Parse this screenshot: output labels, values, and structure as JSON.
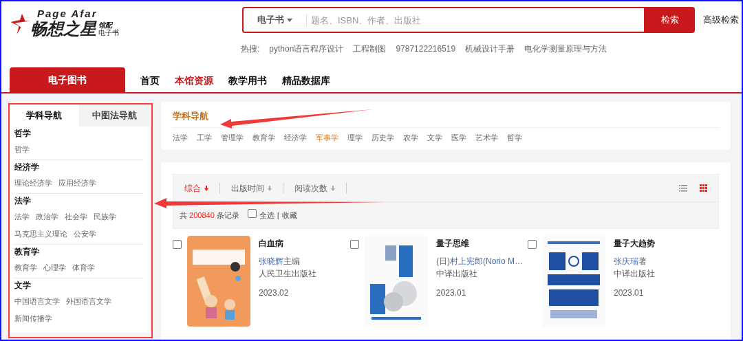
{
  "logo": {
    "latin": "Page Afar",
    "name": "畅想之星",
    "badge_top": "馆配",
    "badge_bottom": "电子书"
  },
  "search": {
    "scope": "电子书",
    "placeholder": "题名、ISBN、作者、出版社",
    "button": "检索",
    "advanced": "高级检索"
  },
  "hot": {
    "label": "热搜:",
    "terms": [
      "python语言程序设计",
      "工程制图",
      "9787122216519",
      "机械设计手册",
      "电化学测量原理与方法"
    ]
  },
  "category_tab": "电子图书",
  "nav": [
    {
      "label": "首页",
      "selected": false
    },
    {
      "label": "本馆资源",
      "selected": true
    },
    {
      "label": "教学用书",
      "selected": false
    },
    {
      "label": "精品数据库",
      "selected": false
    }
  ],
  "sidebar": {
    "tabs": [
      {
        "label": "学科导航",
        "selected": true
      },
      {
        "label": "中图法导航",
        "selected": false
      }
    ],
    "groups": [
      {
        "title": "哲学",
        "links": [
          "哲学"
        ]
      },
      {
        "title": "经济学",
        "links": [
          "理论经济学",
          "应用经济学"
        ]
      },
      {
        "title": "法学",
        "links": [
          "法学",
          "政治学",
          "社会学",
          "民族学",
          "马克思主义理论",
          "公安学"
        ]
      },
      {
        "title": "教育学",
        "links": [
          "教育学",
          "心理学",
          "体育学"
        ]
      },
      {
        "title": "文学",
        "links": [
          "中国语言文学",
          "外国语言文学",
          "新闻传播学"
        ]
      }
    ]
  },
  "subjects": {
    "title": "学科导航",
    "items": [
      {
        "label": "法学",
        "selected": false
      },
      {
        "label": "工学",
        "selected": false
      },
      {
        "label": "管理学",
        "selected": false
      },
      {
        "label": "教育学",
        "selected": false
      },
      {
        "label": "经济学",
        "selected": false
      },
      {
        "label": "军事学",
        "selected": true
      },
      {
        "label": "理学",
        "selected": false
      },
      {
        "label": "历史学",
        "selected": false
      },
      {
        "label": "农学",
        "selected": false
      },
      {
        "label": "文学",
        "selected": false
      },
      {
        "label": "医学",
        "selected": false
      },
      {
        "label": "艺术学",
        "selected": false
      },
      {
        "label": "哲学",
        "selected": false
      }
    ]
  },
  "sort": [
    {
      "label": "综合",
      "selected": true
    },
    {
      "label": "出版时间",
      "selected": false
    },
    {
      "label": "阅读次数",
      "selected": false
    }
  ],
  "views": [
    {
      "kind": "list",
      "selected": false
    },
    {
      "kind": "grid",
      "selected": true
    }
  ],
  "records": {
    "prefix": "共",
    "count": "200840",
    "suffix": "条记录",
    "select_all": "全选",
    "select_all_checked": false,
    "separator": "|",
    "favorite": "收藏"
  },
  "books": [
    {
      "title": "白血病",
      "author": {
        "name": "张晓辉",
        "suffix": "主编"
      },
      "publisher": "人民卫生出版社",
      "date": "2023.02",
      "checked": false
    },
    {
      "title": "量子思维",
      "author": {
        "prefix": "(日)",
        "name": "村上宪郎(Norio M…"
      },
      "publisher": "中译出版社",
      "date": "2023.01",
      "checked": false
    },
    {
      "title": "量子大趋势",
      "author": {
        "name": "张庆瑞",
        "suffix": "著"
      },
      "publisher": "中译出版社",
      "date": "2023.01",
      "checked": false
    }
  ]
}
